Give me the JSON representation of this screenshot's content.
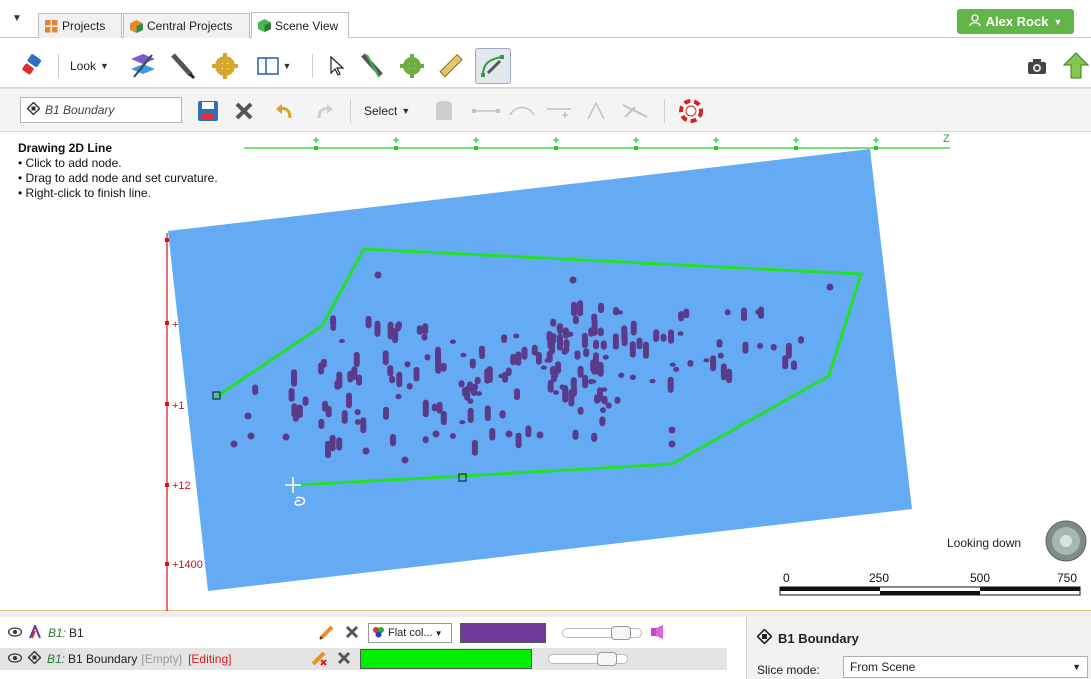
{
  "tabs": {
    "menu_glyph": "▼",
    "items": [
      {
        "label": "Projects"
      },
      {
        "label": "Central Projects"
      },
      {
        "label": "Scene View"
      }
    ],
    "user": "Alex Rock"
  },
  "toolbar1": {
    "look_label": "Look"
  },
  "toolbar2": {
    "object_name": "B1 Boundary",
    "select_label": "Select"
  },
  "scene": {
    "instructions": {
      "title": "Drawing 2D Line",
      "lines": [
        "• Click to add node.",
        "• Drag to add node and set curvature.",
        "• Right-click to finish line."
      ]
    },
    "axis_top_label": "Z",
    "axis_left_labels": [
      "+",
      "+1",
      "+12",
      "+1400"
    ],
    "looking_down": "Looking down",
    "scale_bar": [
      "0",
      "250",
      "500",
      "750"
    ],
    "colors": {
      "plane": "#64abf3",
      "boundary": "#22e02a",
      "points": "#5b3a8c",
      "axis_red": "#d01818",
      "axis_green": "#22cc22"
    }
  },
  "layers": [
    {
      "prefix": "B1:",
      "name": "B1",
      "color_mode": "Flat col...",
      "color": "#6f3a9c"
    },
    {
      "prefix": "B1:",
      "name": "B1 Boundary",
      "empty": "[Empty]",
      "editing": "[Editing]",
      "color": "#00ee00"
    }
  ],
  "properties": {
    "title": "B1 Boundary",
    "slice_mode_label": "Slice mode:",
    "slice_mode_value": "From Scene"
  }
}
